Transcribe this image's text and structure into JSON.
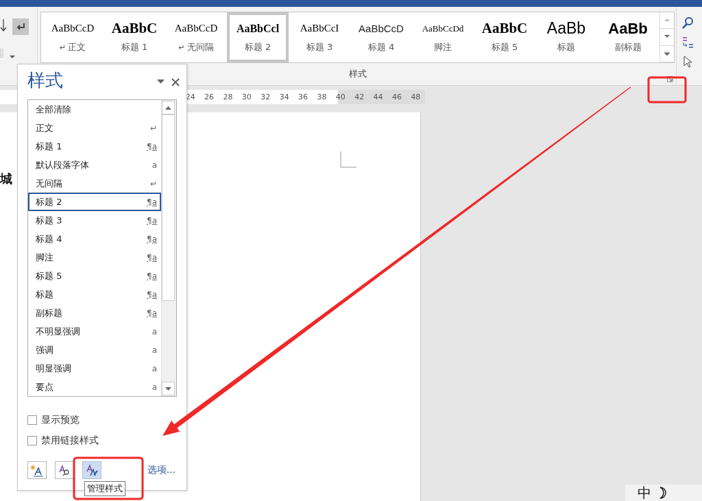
{
  "ribbon": {
    "marks_button": {
      "pressed": true
    },
    "gallery": {
      "items": [
        {
          "preview": "AaBbCcD",
          "kind": "serif",
          "symbol": "↵",
          "label": "正文",
          "selected": false
        },
        {
          "preview": "AaBbC",
          "kind": "serif-heading",
          "label": "标题 1",
          "selected": false
        },
        {
          "preview": "AaBbCcD",
          "kind": "serif",
          "symbol": "↵",
          "label": "无间隔",
          "selected": false
        },
        {
          "preview": "AaBbCcl",
          "kind": "serif-bold",
          "label": "标题 2",
          "selected": true
        },
        {
          "preview": "AaBbCcI",
          "kind": "serif",
          "label": "标题 3",
          "selected": false
        },
        {
          "preview": "AaBbCcD",
          "kind": "sans",
          "label": "标题 4",
          "selected": false
        },
        {
          "preview": "AaBbCcDd",
          "kind": "serif-small",
          "label": "脚注",
          "selected": false
        },
        {
          "preview": "AaBbC",
          "kind": "serif-heading",
          "label": "标题 5",
          "selected": false
        },
        {
          "preview": "AaBb",
          "kind": "sans-large",
          "label": "标题",
          "selected": false
        },
        {
          "preview": "AaBb",
          "kind": "sans-bold-large",
          "label": "副标题",
          "selected": false
        }
      ]
    },
    "group_label": "样式"
  },
  "ruler": {
    "marks": [
      "24",
      "26",
      "28",
      "30",
      "32",
      "34",
      "36",
      "38",
      "40",
      "42",
      "44",
      "46",
      "48"
    ]
  },
  "document": {
    "text": "城"
  },
  "styles_pane": {
    "title": "样式",
    "items": [
      {
        "label": "全部清除",
        "selected": false
      },
      {
        "label": "正文",
        "kind": "paragraph",
        "symbol": "↵",
        "selected": false
      },
      {
        "label": "标题 1",
        "kind": "linked",
        "symbol": "¶a",
        "selected": false
      },
      {
        "label": "默认段落字体",
        "kind": "character",
        "symbol": "a",
        "selected": false
      },
      {
        "label": "无间隔",
        "kind": "paragraph",
        "symbol": "↵",
        "selected": false
      },
      {
        "label": "标题 2",
        "kind": "linked",
        "symbol": "¶a",
        "selected": true
      },
      {
        "label": "标题 3",
        "kind": "linked",
        "symbol": "¶a",
        "selected": false
      },
      {
        "label": "标题 4",
        "kind": "linked",
        "symbol": "¶a",
        "selected": false
      },
      {
        "label": "脚注",
        "kind": "linked",
        "symbol": "¶a",
        "selected": false
      },
      {
        "label": "标题 5",
        "kind": "linked",
        "symbol": "¶a",
        "selected": false
      },
      {
        "label": "标题",
        "kind": "linked",
        "symbol": "¶a",
        "selected": false
      },
      {
        "label": "副标题",
        "kind": "linked",
        "symbol": "¶a",
        "selected": false
      },
      {
        "label": "不明显强调",
        "kind": "character",
        "symbol": "a",
        "selected": false
      },
      {
        "label": "强调",
        "kind": "character",
        "symbol": "a",
        "selected": false
      },
      {
        "label": "明显强调",
        "kind": "character",
        "symbol": "a",
        "selected": false
      },
      {
        "label": "要点",
        "kind": "character",
        "symbol": "a",
        "selected": false
      }
    ],
    "options": [
      {
        "label": "显示预览",
        "checked": false
      },
      {
        "label": "禁用链接样式",
        "checked": false
      }
    ],
    "buttons": [
      {
        "kind": "new-style",
        "highlighted": false
      },
      {
        "kind": "inspector",
        "highlighted": false
      },
      {
        "kind": "manage",
        "highlighted": true
      }
    ],
    "link": "选项...",
    "tooltip": "管理样式"
  },
  "ime": {
    "text": "中"
  }
}
